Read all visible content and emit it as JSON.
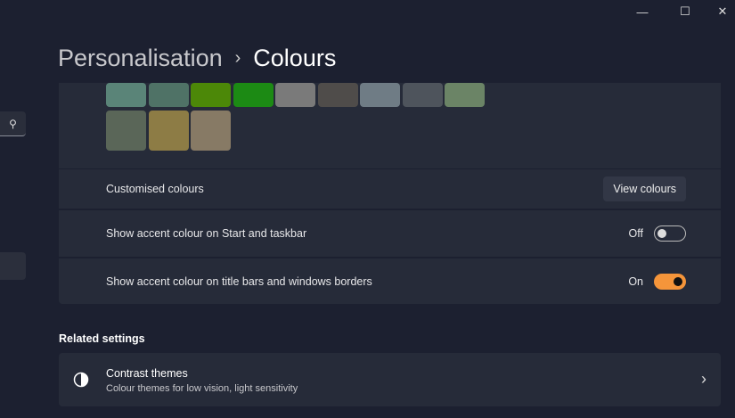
{
  "window": {
    "minimize": "—",
    "maximize": "☐",
    "close": "✕"
  },
  "breadcrumb": {
    "parent": "Personalisation",
    "separator": "›",
    "current": "Colours"
  },
  "swatches": [
    "#5a8478",
    "#4f7266",
    "#4c8808",
    "#1c8a14",
    "#7a7a7a",
    "#4f4c4a",
    "#6f7c85",
    "#4e545c",
    "#6b8466",
    "#5a6658",
    "#8d7c45",
    "#877a65"
  ],
  "rows": {
    "custom": {
      "label": "Customised colours",
      "button": "View colours"
    },
    "start": {
      "label": "Show accent colour on Start and taskbar",
      "state": "Off"
    },
    "title": {
      "label": "Show accent colour on title bars and windows borders",
      "state": "On"
    }
  },
  "related": {
    "heading": "Related settings",
    "contrast": {
      "title": "Contrast themes",
      "subtitle": "Colour themes for low vision, light sensitivity"
    }
  },
  "accent": "#f5953a"
}
